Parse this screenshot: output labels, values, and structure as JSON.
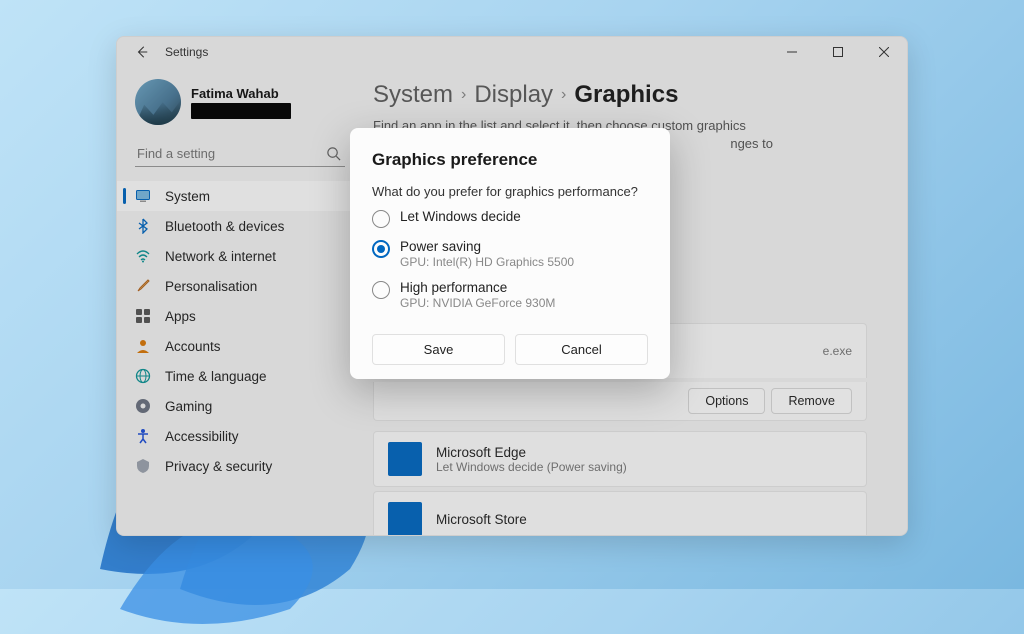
{
  "titlebar": {
    "app_title": "Settings"
  },
  "profile": {
    "name": "Fatima Wahab"
  },
  "search": {
    "placeholder": "Find a setting"
  },
  "nav": {
    "items": [
      {
        "label": "System"
      },
      {
        "label": "Bluetooth & devices"
      },
      {
        "label": "Network & internet"
      },
      {
        "label": "Personalisation"
      },
      {
        "label": "Apps"
      },
      {
        "label": "Accounts"
      },
      {
        "label": "Time & language"
      },
      {
        "label": "Gaming"
      },
      {
        "label": "Accessibility"
      },
      {
        "label": "Privacy & security"
      }
    ]
  },
  "breadcrumb": {
    "a": "System",
    "b": "Display",
    "c": "Graphics"
  },
  "desc_line1": "Find an app in the list and select it, then choose custom graphics",
  "desc_line2_tail": "nges to",
  "app_first": {
    "exe_tail": "e.exe",
    "options": "Options",
    "remove": "Remove"
  },
  "app_edge": {
    "name": "Microsoft Edge",
    "sub": "Let Windows decide (Power saving)"
  },
  "app_store": {
    "name": "Microsoft Store"
  },
  "dialog": {
    "title": "Graphics preference",
    "prompt": "What do you prefer for graphics performance?",
    "opt1": {
      "label": "Let Windows decide"
    },
    "opt2": {
      "label": "Power saving",
      "sub": "GPU: Intel(R) HD Graphics 5500"
    },
    "opt3": {
      "label": "High performance",
      "sub": "GPU: NVIDIA GeForce 930M"
    },
    "save": "Save",
    "cancel": "Cancel"
  }
}
